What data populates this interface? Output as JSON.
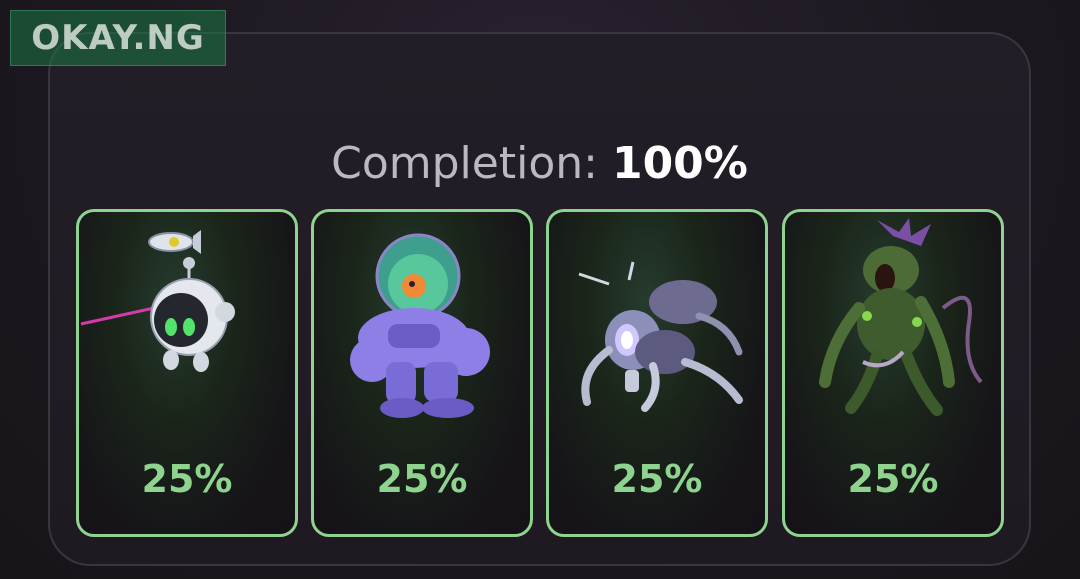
{
  "watermark": {
    "text": "OKAY.NG"
  },
  "completion": {
    "label": "Completion:",
    "value": "100%"
  },
  "cards": [
    {
      "percent": "25%",
      "icon": "robot-drone-icon"
    },
    {
      "percent": "25%",
      "icon": "astronaut-robot-icon"
    },
    {
      "percent": "25%",
      "icon": "spider-bot-icon"
    },
    {
      "percent": "25%",
      "icon": "mutant-creature-icon"
    }
  ],
  "colors": {
    "accent": "#8fd48e",
    "background": "#1d1820",
    "panel_border": "#3b3540",
    "text_muted": "#bdb7c2"
  }
}
